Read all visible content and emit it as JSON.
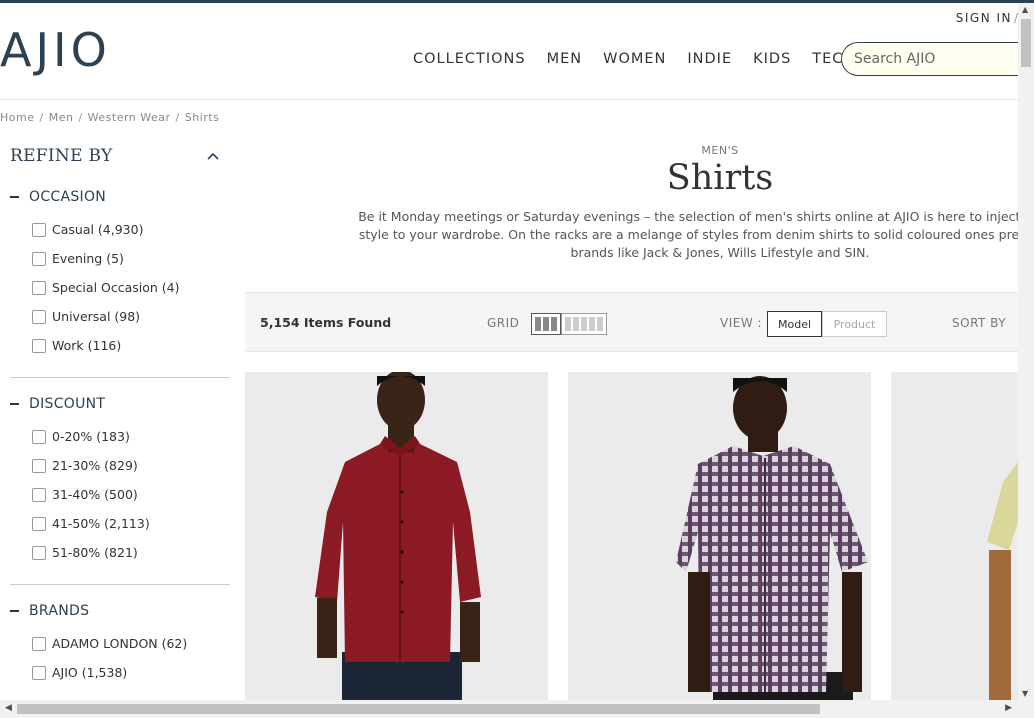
{
  "header": {
    "logo": "AJIO",
    "sign_in": "SIGN IN",
    "sign_in_sep": "/",
    "nav": [
      "COLLECTIONS",
      "MEN",
      "WOMEN",
      "INDIE",
      "KIDS",
      "TECH"
    ],
    "search_placeholder": "Search AJIO"
  },
  "breadcrumb": [
    "Home",
    "Men",
    "Western Wear",
    "Shirts"
  ],
  "sidebar": {
    "refine_title": "REFINE BY",
    "facets": [
      {
        "title": "OCCASION",
        "options": [
          "Casual (4,930)",
          "Evening (5)",
          "Special Occasion (4)",
          "Universal (98)",
          "Work (116)"
        ]
      },
      {
        "title": "DISCOUNT",
        "options": [
          "0-20% (183)",
          "21-30% (829)",
          "31-40% (500)",
          "41-50% (2,113)",
          "51-80% (821)"
        ]
      },
      {
        "title": "BRANDS",
        "options": [
          "ADAMO LONDON (62)",
          "AJIO (1,538)"
        ]
      }
    ]
  },
  "category": {
    "subtitle": "MEN'S",
    "title": "Shirts",
    "description": "Be it Monday meetings or Saturday evenings – the selection of men's shirts online at AJIO is here to inject a dose of style to your wardrobe. On the racks are a melange of styles from denim shirts to solid coloured ones presented by brands like Jack & Jones, Wills Lifestyle and SIN."
  },
  "toolbar": {
    "items_found": "5,154 Items Found",
    "grid_label": "GRID",
    "view_label": "VIEW :",
    "view_model": "Model",
    "view_product": "Product",
    "sort_label": "SORT BY"
  },
  "colors": {
    "brand": "#2c4152",
    "shirt_red": "#8b1a24",
    "shirt_check": "#5a3f5e",
    "shirt_yellow": "#d9d79a"
  }
}
